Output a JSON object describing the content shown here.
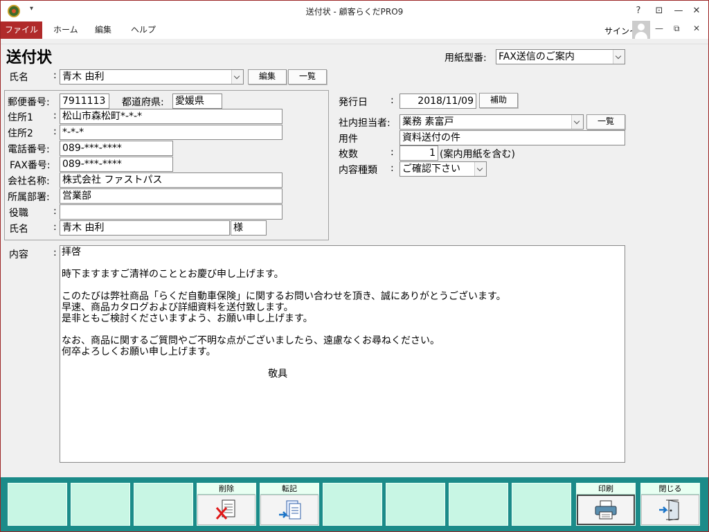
{
  "window": {
    "title": "送付状 - 顧客らくだPRO9",
    "help_glyph": "?",
    "ribbon_glyph": "⊡",
    "min_glyph": "—",
    "max_glyph": "☐",
    "close_glyph": "✕",
    "restore_glyph": "⧉"
  },
  "menu": {
    "file": "ファイル",
    "home": "ホーム",
    "edit": "編集",
    "help": "ヘルプ",
    "signin": "サインイン"
  },
  "form": {
    "heading": "送付状",
    "paper_type_label": "用紙型番:",
    "paper_type_value": "FAX送信のご案内",
    "name_label": "氏名",
    "colon": ":",
    "name_value": "青木 由利",
    "edit_btn": "編集",
    "list_btn": "一覧",
    "postal_label": "郵便番号:",
    "postal_value": "7911113",
    "pref_label": "都道府県:",
    "pref_value": "愛媛県",
    "addr1_label": "住所1",
    "addr1_value": "松山市森松町*-*-*",
    "addr2_label": "住所2",
    "addr2_value": "*-*-*",
    "tel_label": "電話番号:",
    "tel_value": "089-***-****",
    "fax_label": "FAX番号:",
    "fax_value": "089-***-****",
    "company_label": "会社名称:",
    "company_value": "株式会社 ファストパス",
    "dept_label": "所属部署:",
    "dept_value": "営業部",
    "title_label": "役職",
    "title_value": "",
    "name2_label": "氏名",
    "name2_value": "青木 由利",
    "honorific": "様",
    "issue_label": "発行日",
    "issue_value": "2018/11/09",
    "assist_btn": "補助",
    "staff_label": "社内担当者:",
    "staff_value": "業務 素富戸",
    "staff_list_btn": "一覧",
    "subject_label": "用件",
    "subject_value": "資料送付の件",
    "pages_label": "枚数",
    "pages_value": "1",
    "pages_note": "(案内用紙を含む)",
    "kind_label": "内容種類",
    "kind_value": "ご確認下さい",
    "content_label": "内容",
    "content_lines": [
      "拝啓",
      "",
      "時下ますますご清祥のこととお慶び申し上げます。",
      "",
      "このたびは弊社商品「らくだ自動車保険」に関するお問い合わせを頂き、誠にありがとうございます。",
      "早速、商品カタログおよび詳細資料を送付致します。",
      "是非ともご検討くださいますよう、お願い申し上げます。",
      "",
      "なお、商品に関するご質問やご不明な点がございましたら、遠慮なくお尋ねください。",
      "何卒よろしくお願い申し上げます。",
      "",
      "                                                                   敬具"
    ]
  },
  "fkeys": [
    {
      "label": "",
      "icon": ""
    },
    {
      "label": "",
      "icon": ""
    },
    {
      "label": "",
      "icon": ""
    },
    {
      "label": "削除",
      "icon": "delete-doc-icon"
    },
    {
      "label": "転記",
      "icon": "transfer-doc-icon"
    },
    {
      "label": "",
      "icon": ""
    },
    {
      "label": "",
      "icon": ""
    },
    {
      "label": "",
      "icon": ""
    },
    {
      "label": "",
      "icon": ""
    },
    {
      "label": "印刷",
      "icon": "printer-icon"
    },
    {
      "label": "閉じる",
      "icon": "exit-door-icon"
    }
  ],
  "colors": {
    "accent": "#b02a2a",
    "fkey_bar": "#1b8b89",
    "fkey_face": "#c8f6e4"
  }
}
